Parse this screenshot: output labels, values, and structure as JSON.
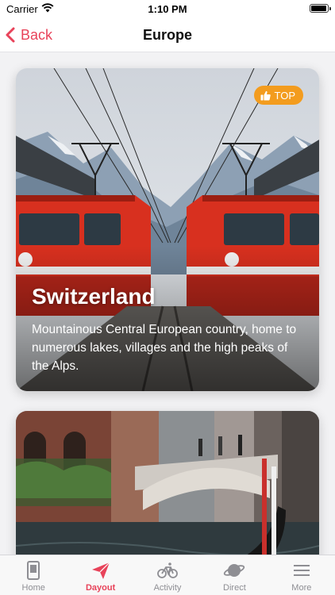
{
  "status_bar": {
    "carrier": "Carrier",
    "time": "1:10 PM"
  },
  "nav": {
    "back_label": "Back",
    "title": "Europe"
  },
  "cards": [
    {
      "badge": "TOP",
      "title": "Switzerland",
      "description": "Mountainous Central European country, home to numerous lakes, villages and the high peaks of the Alps."
    },
    {
      "badge": "",
      "title": "",
      "description": ""
    }
  ],
  "tabs": [
    {
      "label": "Home",
      "icon": "home-icon",
      "active": false
    },
    {
      "label": "Dayout",
      "icon": "paper-plane-icon",
      "active": true
    },
    {
      "label": "Activity",
      "icon": "bicycle-icon",
      "active": false
    },
    {
      "label": "Direct",
      "icon": "planet-icon",
      "active": false
    },
    {
      "label": "More",
      "icon": "menu-icon",
      "active": false
    }
  ],
  "colors": {
    "accent": "#e8435a",
    "badge": "#f39c1e",
    "train": "#d8301f"
  }
}
